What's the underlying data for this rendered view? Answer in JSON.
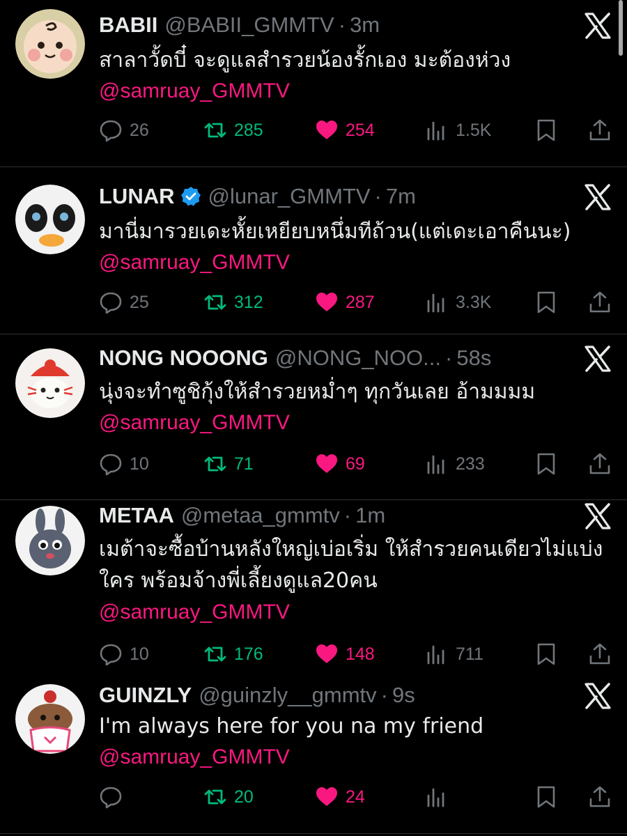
{
  "colors": {
    "background": "#000000",
    "text": "#e7e9ea",
    "muted": "#71767b",
    "mention": "#f91880",
    "retweet": "#00ba7c",
    "like": "#f91880",
    "verified": "#1d9bf0"
  },
  "icons": {
    "reply": "reply-icon",
    "retweet": "retweet-icon",
    "like": "heart-icon",
    "views": "views-icon",
    "bookmark": "bookmark-icon",
    "share": "share-icon",
    "logo": "x-logo-icon"
  },
  "tweets": [
    {
      "name": "BABII",
      "verified": false,
      "handle": "@BABII_GMMTV",
      "separator": "·",
      "time": "3m",
      "text": "สาลาวั้ดบี๋ จะดูแลสำรวยน้องรั้กเอง มะต้องห่วง",
      "mention": "@samruay_GMMTV",
      "replies": "26",
      "retweets": "285",
      "likes": "254",
      "views": "1.5K"
    },
    {
      "name": "LUNAR",
      "verified": true,
      "handle": "@lunar_GMMTV",
      "separator": "·",
      "time": "7m",
      "text": "มานี่มารวยเดะหั้ยเหยียบหนึ่มทีถ้วน(แต่เดะเอาคืนนะ)",
      "mention": "@samruay_GMMTV",
      "replies": "25",
      "retweets": "312",
      "likes": "287",
      "views": "3.3K"
    },
    {
      "name": "NONG NOOONG",
      "verified": false,
      "handle": "@NONG_NOO...",
      "separator": "·",
      "time": "58s",
      "text": "นุ่งจะทำซูชิกุ้งให้สำรวยหม่ำๆ ทุกวันเลย อ้ามมมม",
      "mention": "@samruay_GMMTV",
      "replies": "10",
      "retweets": "71",
      "likes": "69",
      "views": "233"
    },
    {
      "name": "METAA",
      "verified": false,
      "handle": "@metaa_gmmtv",
      "separator": "·",
      "time": "1m",
      "text": "เมต้าจะซื้อบ้านหลังใหญ่เบ่อเริ่ม ให้สำรวยคนเดียวไม่แบ่งใคร พร้อมจ้างพี่เลี้ยงดูแล20คน",
      "mention": "@samruay_GMMTV",
      "replies": "10",
      "retweets": "176",
      "likes": "148",
      "views": "711"
    },
    {
      "name": "GUINZLY",
      "verified": false,
      "handle": "@guinzly__gmmtv",
      "separator": "·",
      "time": "9s",
      "text": "I'm always here for you na my friend",
      "mention": "@samruay_GMMTV",
      "replies": "",
      "retweets": "20",
      "likes": "24",
      "views": ""
    }
  ]
}
